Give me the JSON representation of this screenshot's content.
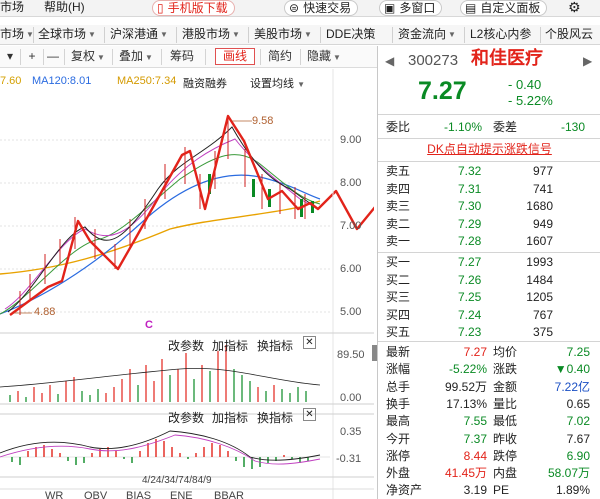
{
  "menu": {
    "items": [
      "市场",
      "帮助(H)"
    ],
    "mobile_download": "手机版下载",
    "quick_trade": "快速交易",
    "multi_window": "多窗口",
    "custom_panel": "自定义面板"
  },
  "market_tabs": {
    "left": [
      "市场",
      "全球市场",
      "沪深港通",
      "港股市场",
      "美股市场",
      "DDE决策"
    ],
    "right": [
      "资金流向",
      "L2核心内参",
      "个股风云"
    ]
  },
  "toolbar": {
    "plus": "+",
    "minus": "—",
    "adjust": "复权",
    "overlay": "叠加",
    "chips": "筹码",
    "draw": "画线",
    "simple": "简约",
    "hide": "隐藏"
  },
  "chart": {
    "ma_labels": [
      {
        "text": "7.60",
        "color": "#d4a000"
      },
      {
        "text": "MA120:8.01",
        "color": "#2a6be0"
      },
      {
        "text": "MA250:7.34",
        "color": "#d49a00"
      },
      {
        "text": "融资融券",
        "color": "#222222"
      },
      {
        "text": "设置均线",
        "color": "#222222"
      }
    ],
    "y_labels": [
      "9.00",
      "8.00",
      "7.00",
      "6.00",
      "5.00"
    ],
    "high_label": "9.58",
    "low_label": "4.88",
    "marker": "C",
    "volume_toolbar": [
      "改参数",
      "加指标",
      "换指标"
    ],
    "volume_axis": [
      "89.50",
      "0.00"
    ],
    "macd_toolbar": [
      "改参数",
      "加指标",
      "换指标"
    ],
    "macd_axis": [
      "0.35",
      "-0.31"
    ],
    "date_axis": "4/24/34/74/84/9",
    "bottom_tabs": [
      "WR",
      "OBV",
      "BIAS",
      "ENE",
      "BBAR"
    ]
  },
  "quote": {
    "code": "300273",
    "name": "和佳医疗",
    "price": "7.27",
    "change": "- 0.40",
    "change_pct": "- 5.22%",
    "weibi_label": "委比",
    "weibi_value": "-1.10%",
    "weicha_label": "委差",
    "weicha_value": "-130",
    "dk_link": "DK点自动提示涨跌信号",
    "asks": [
      {
        "label": "卖五",
        "price": "7.32",
        "volume": "977"
      },
      {
        "label": "卖四",
        "price": "7.31",
        "volume": "741"
      },
      {
        "label": "卖三",
        "price": "7.30",
        "volume": "1680"
      },
      {
        "label": "卖二",
        "price": "7.29",
        "volume": "949"
      },
      {
        "label": "卖一",
        "price": "7.28",
        "volume": "1607"
      }
    ],
    "bids": [
      {
        "label": "买一",
        "price": "7.27",
        "volume": "1993"
      },
      {
        "label": "买二",
        "price": "7.26",
        "volume": "1484"
      },
      {
        "label": "买三",
        "price": "7.25",
        "volume": "1205"
      },
      {
        "label": "买四",
        "price": "7.24",
        "volume": "767"
      },
      {
        "label": "买五",
        "price": "7.23",
        "volume": "375"
      }
    ],
    "stats": [
      {
        "l1": "最新",
        "v1": "7.27",
        "c1": "red",
        "l2": "均价",
        "v2": "7.25",
        "c2": "green"
      },
      {
        "l1": "涨幅",
        "v1": "-5.22%",
        "c1": "green",
        "l2": "涨跌",
        "v2": "▼0.40",
        "c2": "green"
      },
      {
        "l1": "总手",
        "v1": "99.52万",
        "c1": "black",
        "l2": "金额",
        "v2": "7.22亿",
        "c2": "blue"
      },
      {
        "l1": "换手",
        "v1": "17.13%",
        "c1": "black",
        "l2": "量比",
        "v2": "0.65",
        "c2": "black"
      },
      {
        "l1": "最高",
        "v1": "7.55",
        "c1": "green",
        "l2": "最低",
        "v2": "7.02",
        "c2": "green"
      },
      {
        "l1": "今开",
        "v1": "7.37",
        "c1": "green",
        "l2": "昨收",
        "v2": "7.67",
        "c2": "black"
      },
      {
        "l1": "涨停",
        "v1": "8.44",
        "c1": "red",
        "l2": "跌停",
        "v2": "6.90",
        "c2": "green"
      },
      {
        "l1": "外盘",
        "v1": "41.45万",
        "c1": "red",
        "l2": "内盘",
        "v2": "58.07万",
        "c2": "green"
      },
      {
        "l1": "净资产",
        "v1": "3.19",
        "c1": "black",
        "l2": "PE",
        "v2": "1.89%",
        "c2": "black"
      }
    ]
  },
  "colors": {
    "up": "#e2231a",
    "down": "#0a8a24",
    "accent_blue": "#1a4fc4"
  }
}
